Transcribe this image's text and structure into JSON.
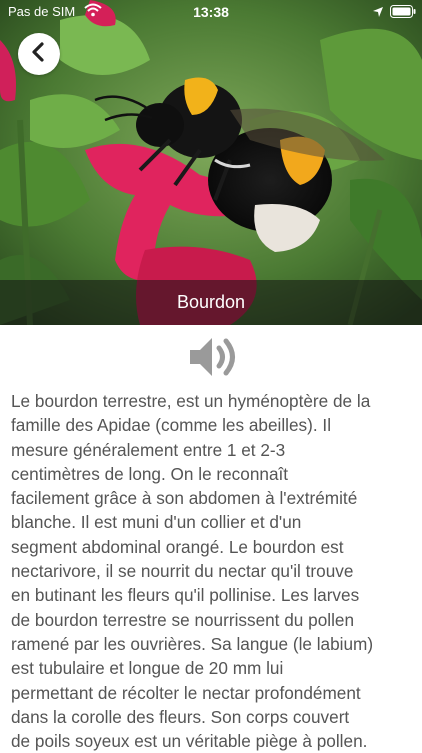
{
  "status_bar": {
    "carrier": "Pas de SIM",
    "time": "13:38"
  },
  "icons": {
    "back": "chevron-left-icon",
    "audio": "speaker-icon",
    "wifi": "wifi-icon",
    "location": "location-arrow-icon",
    "battery": "battery-icon"
  },
  "header": {
    "title": "Bourdon"
  },
  "description": "Le bourdon terrestre, est un hyménoptère de la\nfamille des Apidae (comme les abeilles). Il\nmesure généralement entre 1 et  2-3\ncentimètres de long. On le reconnaît\nfacilement grâce à son abdomen à l'extrémité\nblanche. Il est muni d'un collier et d'un\nsegment abdominal orangé. Le bourdon est\nnectarivore, il se nourrit du nectar qu'il trouve\nen butinant les fleurs qu'il pollinise. Les larves\nde bourdon terrestre se nourrissent du pollen\nramené par les ouvrières. Sa langue (le labium)\nest tubulaire et longue de 20 mm lui\npermettant de récolter le nectar profondément\ndans la corolle des fleurs. Son corps couvert\nde poils soyeux est un véritable piège à pollen.",
  "colors": {
    "text": "#555555",
    "flower": "#e0245e",
    "band": "#1a1a1a"
  }
}
